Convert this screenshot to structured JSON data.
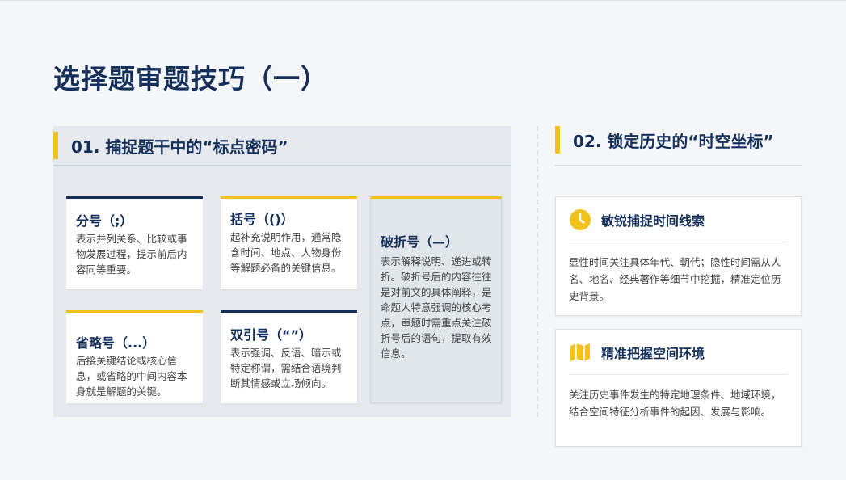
{
  "title": "选择题审题技巧（一）",
  "section1": {
    "title": "01. 捕捉题干中的“标点密码”",
    "cards": [
      {
        "title": "分号（;）",
        "body": "表示并列关系、比较或事物发展过程，提示前后内容同等重要。"
      },
      {
        "title": "括号（()）",
        "body": "起补充说明作用，通常隐含时间、地点、人物身份等解题必备的关键信息。"
      },
      {
        "title": "破折号（—）",
        "body": "表示解释说明、递进或转折。破折号后的内容往往是对前文的具体阐释，是命题人特意强调的核心考点，审题时需重点关注破折号后的语句，提取有效信息。"
      },
      {
        "title": "省略号（...）",
        "body": "后接关键结论或核心信息，或省略的中间内容本身就是解题的关键。"
      },
      {
        "title": "双引号（“”）",
        "body": "表示强调、反语、暗示或特定称谓，需结合语境判断其情感或立场倾向。"
      }
    ]
  },
  "section2": {
    "title": "02. 锁定历史的“时空坐标”",
    "cards": [
      {
        "icon": "clock-icon",
        "title": "敏锐捕捉时间线索",
        "body": "显性时间关注具体年代、朝代；隐性时间需从人名、地名、经典著作等细节中挖掘，精准定位历史背景。"
      },
      {
        "icon": "map-icon",
        "title": "精准把握空间环境",
        "body": "关注历史事件发生的特定地理条件、地域环境，结合空间特征分析事件的起因、发展与影响。"
      }
    ]
  },
  "colors": {
    "navy": "#14305a",
    "gold": "#f2c21a"
  }
}
